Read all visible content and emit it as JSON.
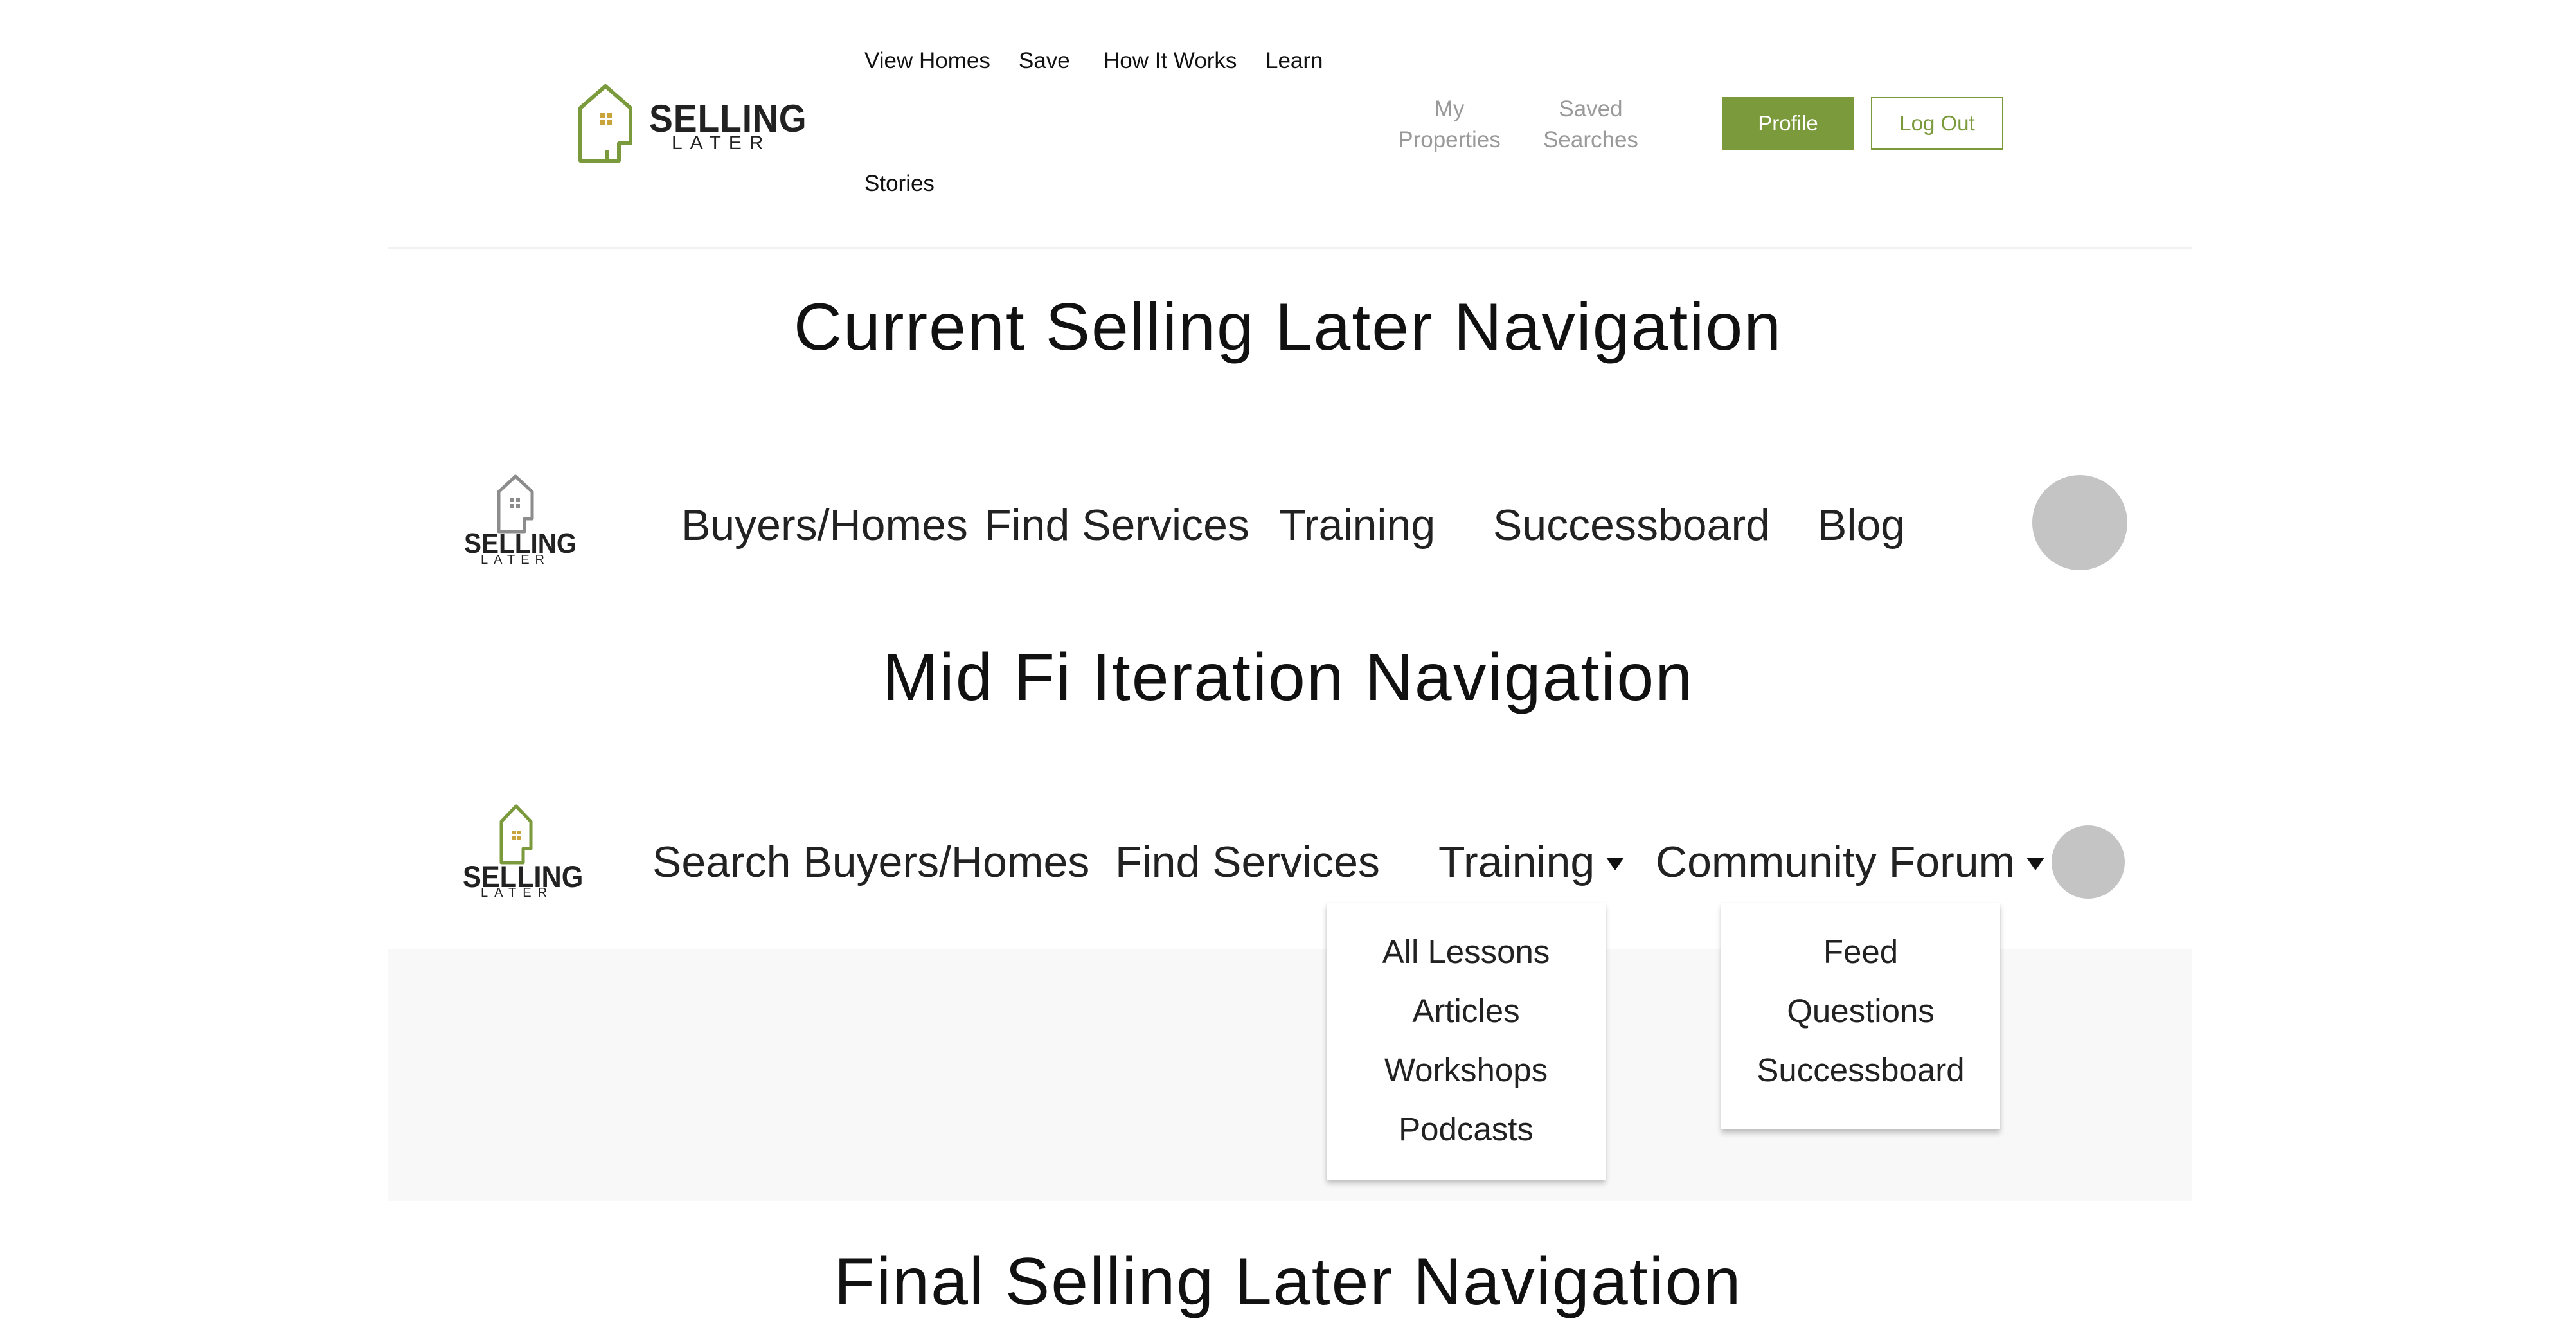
{
  "colors": {
    "brand_green": "#7a9a3c",
    "logo_gold": "#c9a43a",
    "mid_fi_gray": "#8c8c8c",
    "text_dark": "#111111",
    "account_gray": "#9a9a9a",
    "avatar_gray": "#c4c4c4",
    "band_bg": "#f8f8f8"
  },
  "current_nav": {
    "logo": {
      "word1": "SELLING",
      "word2": "LATER",
      "icon": "house-logo-icon"
    },
    "links": [
      {
        "label": "View Homes"
      },
      {
        "label": "Save"
      },
      {
        "label": "How It Works"
      },
      {
        "label": "Learn"
      },
      {
        "label": "Stories"
      }
    ],
    "account_links": [
      {
        "line1": "My",
        "line2": "Properties"
      },
      {
        "line1": "Saved",
        "line2": "Searches"
      }
    ],
    "profile_button": "Profile",
    "logout_button": "Log Out",
    "caption": "Current Selling Later Navigation"
  },
  "mid_fi_nav": {
    "logo": {
      "word1": "SELLING",
      "word2": "LATER",
      "icon": "house-logo-icon"
    },
    "links": [
      {
        "label": "Buyers/Homes"
      },
      {
        "label": "Find Services"
      },
      {
        "label": "Training"
      },
      {
        "label": "Successboard"
      },
      {
        "label": "Blog"
      }
    ],
    "avatar_icon": "avatar-placeholder",
    "caption": "Mid Fi Iteration Navigation"
  },
  "final_nav": {
    "logo": {
      "word1": "SELLING",
      "word2": "LATER",
      "icon": "house-logo-icon"
    },
    "links": [
      {
        "label": "Search Buyers/Homes"
      },
      {
        "label": "Find Services"
      },
      {
        "label": "Training",
        "icon": "caret-down-icon"
      },
      {
        "label": "Community Forum",
        "icon": "caret-down-icon"
      }
    ],
    "training_menu": [
      "All Lessons",
      "Articles",
      "Workshops",
      "Podcasts"
    ],
    "community_menu": [
      "Feed",
      "Questions",
      "Successboard"
    ],
    "avatar_icon": "avatar-placeholder",
    "caption": "Final Selling Later Navigation"
  }
}
